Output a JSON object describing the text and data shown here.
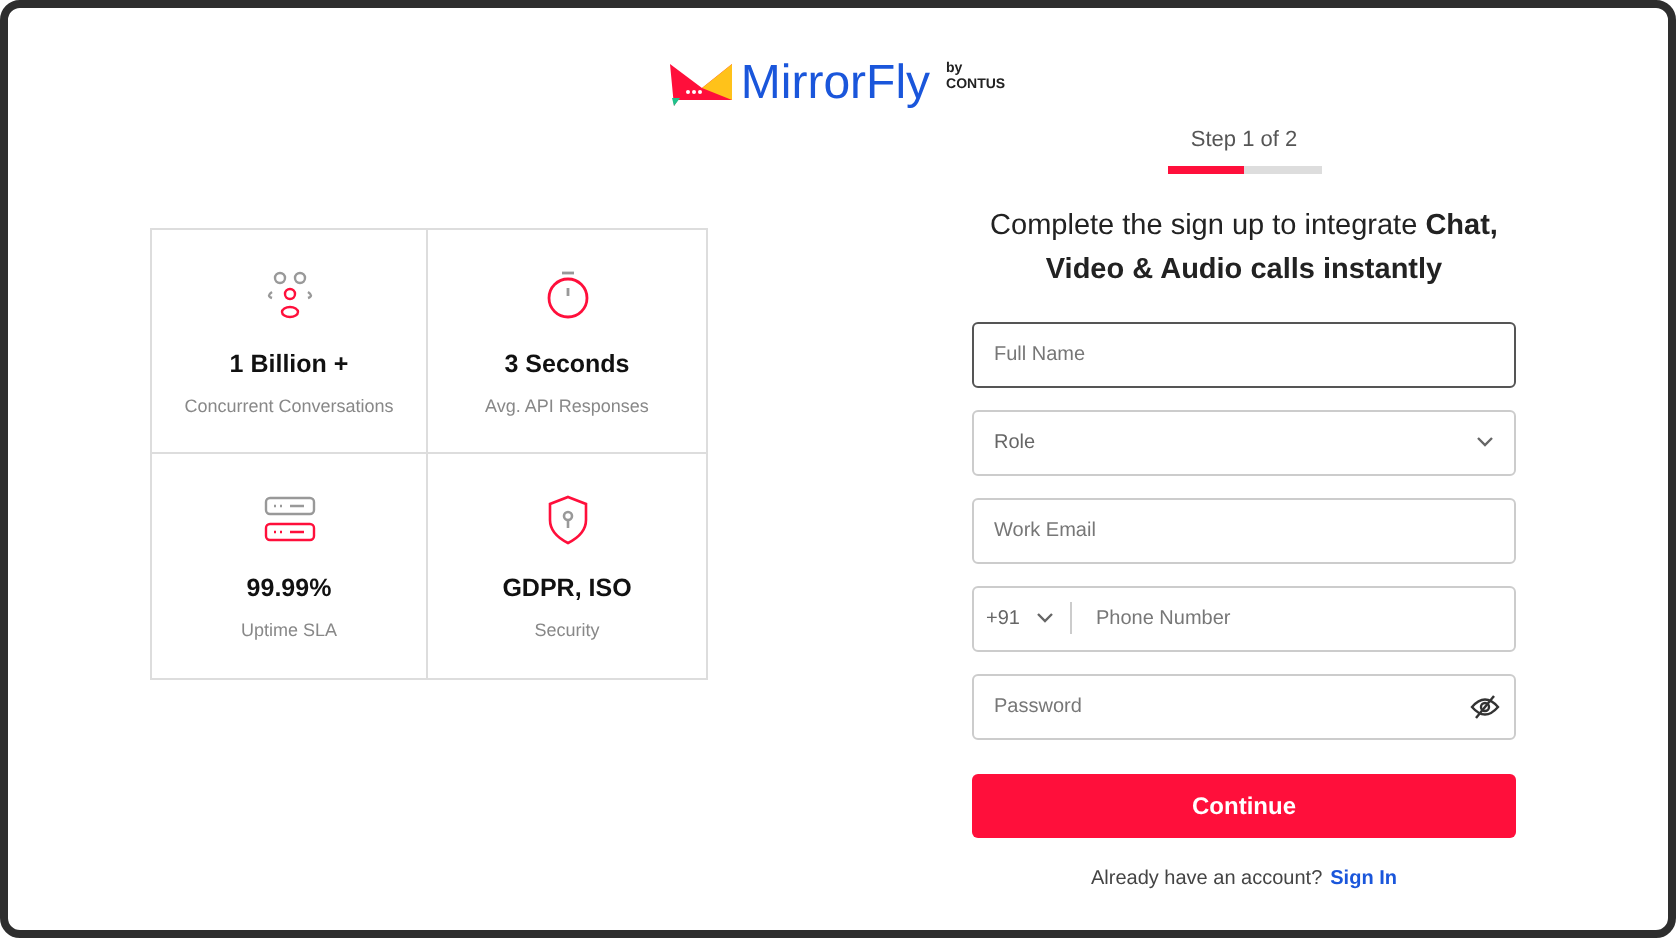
{
  "logo": {
    "name": "MirrorFly",
    "by": "by",
    "company": "CONTUS"
  },
  "step": {
    "label": "Step 1 of 2",
    "level": 0.5
  },
  "heading": "Complete the sign up to integrate **Chat,** **Video & Audio calls instantly**",
  "stats": [
    {
      "kind": "people",
      "value": "1 Billion +",
      "caption": "Concurrent Conversations"
    },
    {
      "kind": "timer",
      "value": "3 Seconds",
      "caption": "Avg. API Responses"
    },
    {
      "kind": "server",
      "value": "99.99%",
      "caption": "Uptime SLA"
    },
    {
      "kind": "shield",
      "value": "GDPR, ISO",
      "caption": "Security"
    }
  ],
  "fields": [
    {
      "kind": "text",
      "placeholder": "Full Name",
      "focused": true
    },
    {
      "kind": "select",
      "placeholder": "Role"
    },
    {
      "kind": "email",
      "placeholder": "Work Email"
    },
    {
      "kind": "phone",
      "code": "+91",
      "placeholder": "Phone Number"
    },
    {
      "kind": "password",
      "placeholder": "Password"
    }
  ],
  "submit": "Continue",
  "signin": {
    "question": "Already have an account?",
    "link": "Sign In"
  }
}
